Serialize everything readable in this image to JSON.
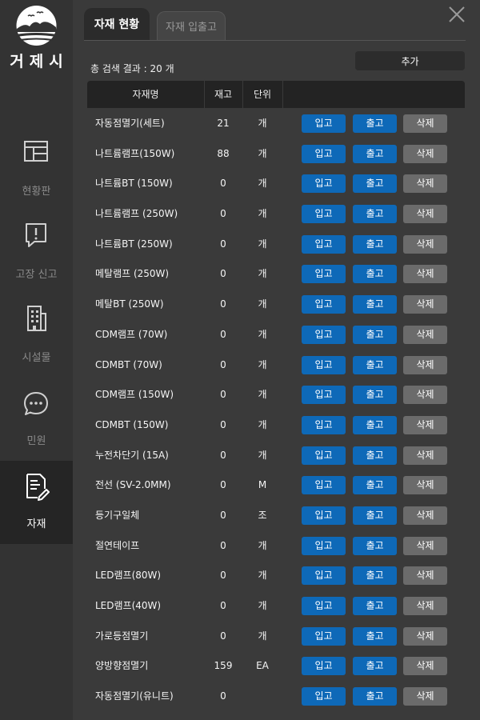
{
  "app": {
    "logo_text": "거제시"
  },
  "sidebar": {
    "items": [
      {
        "label": "현황판",
        "icon": "dashboard-icon"
      },
      {
        "label": "고장 신고",
        "icon": "fault-report-icon"
      },
      {
        "label": "시설물",
        "icon": "building-icon"
      },
      {
        "label": "민원",
        "icon": "chat-bubble-icon"
      },
      {
        "label": "자재",
        "icon": "document-edit-icon",
        "active": true
      }
    ]
  },
  "tabs": [
    {
      "label": "자재 현황",
      "active": true
    },
    {
      "label": "자재 입출고",
      "active": false
    }
  ],
  "toolbar": {
    "result_count": "총 검색 결과 : 20 개",
    "add_label": "추가"
  },
  "table": {
    "headers": {
      "name": "자재명",
      "stock": "재고",
      "unit": "단위"
    },
    "buttons": {
      "in": "입고",
      "out": "출고",
      "delete": "삭제"
    },
    "rows": [
      {
        "name": "자동점멸기(세트)",
        "stock": "21",
        "unit": "개"
      },
      {
        "name": "나트륨램프(150W)",
        "stock": "88",
        "unit": "개"
      },
      {
        "name": "나트륨BT (150W)",
        "stock": "0",
        "unit": "개"
      },
      {
        "name": "나트륨램프 (250W)",
        "stock": "0",
        "unit": "개"
      },
      {
        "name": "나트륨BT (250W)",
        "stock": "0",
        "unit": "개"
      },
      {
        "name": "메탈램프 (250W)",
        "stock": "0",
        "unit": "개"
      },
      {
        "name": "메탈BT (250W)",
        "stock": "0",
        "unit": "개"
      },
      {
        "name": "CDM램프 (70W)",
        "stock": "0",
        "unit": "개"
      },
      {
        "name": "CDMBT (70W)",
        "stock": "0",
        "unit": "개"
      },
      {
        "name": "CDM램프 (150W)",
        "stock": "0",
        "unit": "개"
      },
      {
        "name": "CDMBT (150W)",
        "stock": "0",
        "unit": "개"
      },
      {
        "name": "누전차단기 (15A)",
        "stock": "0",
        "unit": "개"
      },
      {
        "name": "전선 (SV-2.0MM)",
        "stock": "0",
        "unit": "M"
      },
      {
        "name": "등기구일체",
        "stock": "0",
        "unit": "조"
      },
      {
        "name": "절연테이프",
        "stock": "0",
        "unit": "개"
      },
      {
        "name": "LED램프(80W)",
        "stock": "0",
        "unit": "개"
      },
      {
        "name": "LED램프(40W)",
        "stock": "0",
        "unit": "개"
      },
      {
        "name": "가로등점멸기",
        "stock": "0",
        "unit": "개"
      },
      {
        "name": "양방향점멸기",
        "stock": "159",
        "unit": "EA"
      },
      {
        "name": "자동점멸기(유니트)",
        "stock": "0",
        "unit": ""
      }
    ]
  },
  "colors": {
    "accent_blue": "#0e69b8",
    "delete_gray": "#6b6b6b",
    "tab_active_text": "#ffffff"
  }
}
